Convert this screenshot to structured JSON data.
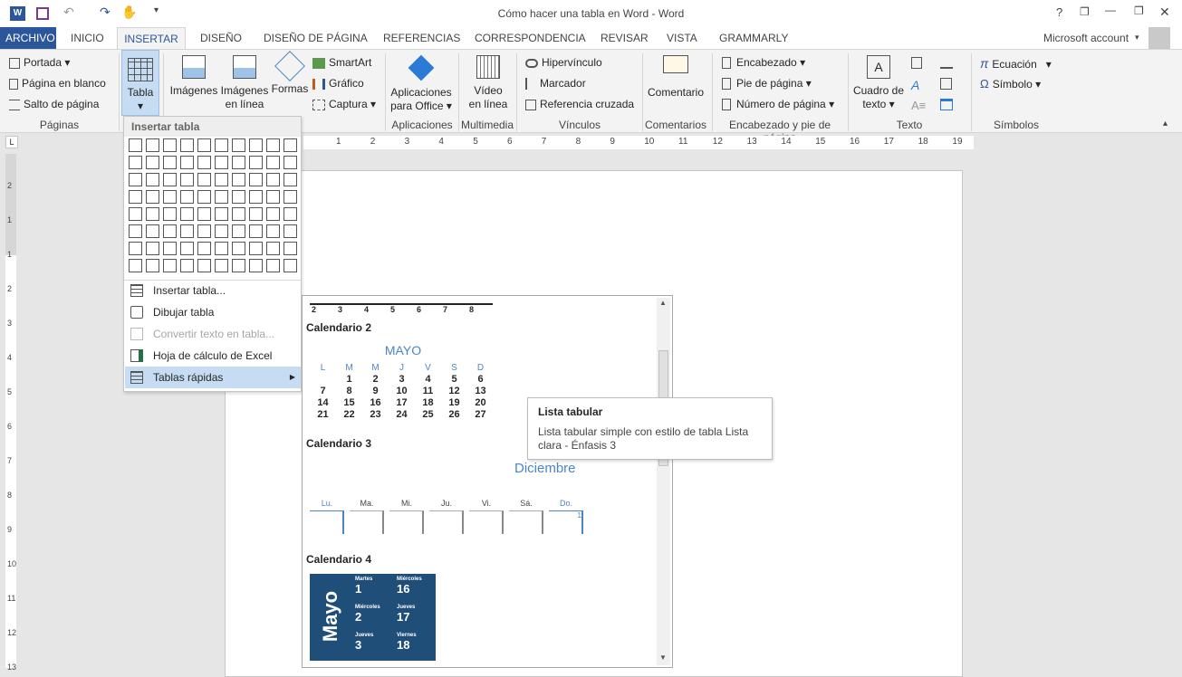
{
  "window": {
    "title": "Cómo hacer una tabla en Word - Word",
    "help": "?",
    "minimize": "—",
    "restore": "❐",
    "close": "✕"
  },
  "tabs": [
    "ARCHIVO",
    "INICIO",
    "INSERTAR",
    "DISEÑO",
    "DISEÑO DE PÁGINA",
    "REFERENCIAS",
    "CORRESPONDENCIA",
    "REVISAR",
    "VISTA",
    "GRAMMARLY"
  ],
  "account": "Microsoft account",
  "groups": {
    "paginas": {
      "label": "Páginas",
      "portada": "Portada",
      "pagina_blanco": "Página en blanco",
      "salto": "Salto de página"
    },
    "tablas": {
      "tabla": "Tabla"
    },
    "ilustraciones": {
      "imagenes": "Imágenes",
      "imagenes_linea_1": "Imágenes",
      "imagenes_linea_2": "en línea",
      "formas": "Formas",
      "smartart": "SmartArt",
      "grafico": "Gráfico",
      "captura": "Captura"
    },
    "aplicaciones": {
      "label": "Aplicaciones",
      "btn_1": "Aplicaciones",
      "btn_2": "para Office"
    },
    "multimedia": {
      "label": "Multimedia",
      "btn_1": "Vídeo",
      "btn_2": "en línea"
    },
    "vinculos": {
      "label": "Vínculos",
      "hipervinculo": "Hipervínculo",
      "marcador": "Marcador",
      "referencia": "Referencia cruzada"
    },
    "comentarios": {
      "label": "Comentarios",
      "comentario": "Comentario"
    },
    "encabezado": {
      "label": "Encabezado y pie de página",
      "encabezado": "Encabezado",
      "pie": "Pie de página",
      "numero": "Número de página"
    },
    "texto": {
      "label": "Texto",
      "cuadro_1": "Cuadro de",
      "cuadro_2": "texto"
    },
    "simbolos": {
      "label": "Símbolos",
      "ecuacion": "Ecuación",
      "simbolo": "Símbolo"
    }
  },
  "dropdown": {
    "header": "Insertar tabla",
    "items": [
      "Insertar tabla...",
      "Dibujar tabla",
      "Convertir texto en tabla...",
      "Hoja de cálculo de Excel",
      "Tablas rápidas"
    ]
  },
  "ruler": {
    "numbers": [
      "1",
      "2",
      "3",
      "4",
      "5",
      "6",
      "7",
      "8",
      "9",
      "10",
      "11",
      "12",
      "13",
      "14",
      "15",
      "16",
      "17",
      "18",
      "19"
    ],
    "vertical": [
      "2",
      "1",
      "1",
      "2",
      "3",
      "4",
      "5",
      "6",
      "7",
      "8",
      "9",
      "10",
      "11",
      "12",
      "13"
    ]
  },
  "gallery": {
    "top_numbers": [
      "2",
      "3",
      "4",
      "5",
      "6",
      "7",
      "8"
    ],
    "cal2": {
      "title": "Calendario 2",
      "month": "MAYO",
      "days": [
        "L",
        "M",
        "M",
        "J",
        "V",
        "S",
        "D"
      ],
      "weeks": [
        [
          "",
          "1",
          "2",
          "3",
          "4",
          "5",
          "6"
        ],
        [
          "7",
          "8",
          "9",
          "10",
          "11",
          "12",
          "13"
        ],
        [
          "14",
          "15",
          "16",
          "17",
          "18",
          "19",
          "20"
        ],
        [
          "21",
          "22",
          "23",
          "24",
          "25",
          "26",
          "27"
        ]
      ]
    },
    "cal3": {
      "title": "Calendario 3",
      "month": "Diciembre",
      "days": [
        "Lu.",
        "Ma.",
        "Mi.",
        "Ju.",
        "Vi.",
        "Sá.",
        "Do."
      ],
      "first": "1"
    },
    "cal4": {
      "title": "Calendario 4",
      "month": "Mayo",
      "cells": [
        {
          "d": "Martes",
          "n": "1"
        },
        {
          "d": "Miércoles",
          "n": "16"
        },
        {
          "d": "Miércoles",
          "n": "2"
        },
        {
          "d": "Jueves",
          "n": "17"
        },
        {
          "d": "Jueves",
          "n": "3"
        },
        {
          "d": "Viernes",
          "n": "18"
        }
      ]
    }
  },
  "tooltip": {
    "title": "Lista tabular",
    "body": "Lista tabular simple con estilo de tabla Lista clara - Énfasis 3"
  }
}
